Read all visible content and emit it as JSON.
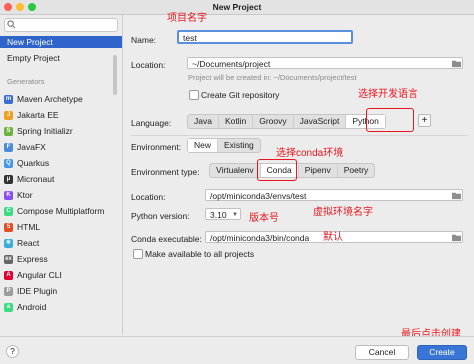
{
  "window": {
    "title": "New Project"
  },
  "sidebar": {
    "top_items": [
      {
        "label": "New Project"
      },
      {
        "label": "Empty Project"
      }
    ],
    "section_label": "Generators",
    "generators": [
      {
        "label": "Maven Archetype",
        "icon": "maven-icon",
        "color": "#3b6bd6",
        "glyph": "m"
      },
      {
        "label": "Jakarta EE",
        "icon": "jakarta-icon",
        "color": "#f0a020",
        "glyph": "J"
      },
      {
        "label": "Spring Initializr",
        "icon": "spring-icon",
        "color": "#6db33f",
        "glyph": "S"
      },
      {
        "label": "JavaFX",
        "icon": "javafx-icon",
        "color": "#4a8ed9",
        "glyph": "F"
      },
      {
        "label": "Quarkus",
        "icon": "quarkus-icon",
        "color": "#4695eb",
        "glyph": "Q"
      },
      {
        "label": "Micronaut",
        "icon": "micronaut-icon",
        "color": "#333333",
        "glyph": "μ"
      },
      {
        "label": "Ktor",
        "icon": "ktor-icon",
        "color": "#8a4ff0",
        "glyph": "K"
      },
      {
        "label": "Compose Multiplatform",
        "icon": "compose-icon",
        "color": "#3ddc84",
        "glyph": "C"
      },
      {
        "label": "HTML",
        "icon": "html-icon",
        "color": "#e44d26",
        "glyph": "5"
      },
      {
        "label": "React",
        "icon": "react-icon",
        "color": "#3aaed8",
        "glyph": "⚛"
      },
      {
        "label": "Express",
        "icon": "express-icon",
        "color": "#666666",
        "glyph": "ex"
      },
      {
        "label": "Angular CLI",
        "icon": "angular-icon",
        "color": "#dd0031",
        "glyph": "A"
      },
      {
        "label": "IDE Plugin",
        "icon": "plugin-icon",
        "color": "#9c9c9c",
        "glyph": "P"
      },
      {
        "label": "Android",
        "icon": "android-icon",
        "color": "#3ddc84",
        "glyph": "a"
      }
    ]
  },
  "form": {
    "name_label": "Name:",
    "name_value": "test",
    "location_label": "Location:",
    "location_value": "~/Documents/project",
    "location_hint": "Project will be created in: ~/Documents/project/test",
    "git_label": "Create Git repository",
    "language_label": "Language:",
    "languages": [
      {
        "label": "Java",
        "selected": false
      },
      {
        "label": "Kotlin",
        "selected": false
      },
      {
        "label": "Groovy",
        "selected": false
      },
      {
        "label": "JavaScript",
        "selected": false
      },
      {
        "label": "Python",
        "selected": true
      }
    ],
    "plus_label": "+",
    "environment_label": "Environment:",
    "environments": [
      {
        "label": "New",
        "selected": true
      },
      {
        "label": "Existing",
        "selected": false
      }
    ],
    "env_type_label": "Environment type:",
    "env_types": [
      {
        "label": "Virtualenv",
        "selected": false
      },
      {
        "label": "Conda",
        "selected": true
      },
      {
        "label": "Pipenv",
        "selected": false
      },
      {
        "label": "Poetry",
        "selected": false
      }
    ],
    "conda_location_label": "Location:",
    "conda_location_value": "/opt/miniconda3/envs/test",
    "python_version_label": "Python version:",
    "python_version_value": "3.10",
    "conda_exec_label": "Conda executable:",
    "conda_exec_value": "/opt/miniconda3/bin/conda",
    "available_label": "Make available to all projects"
  },
  "annotations": {
    "project_name": "项目名字",
    "select_language": "选择开发语言",
    "select_conda": "选择conda环境",
    "env_name": "虚拟环境名字",
    "version": "版本号",
    "default": "默认",
    "create_last": "最后点击创建"
  },
  "footer": {
    "help_label": "?",
    "cancel_label": "Cancel",
    "create_label": "Create"
  },
  "colors": {
    "accent": "#2f65ca",
    "annotation": "#e8171f",
    "create": "#3875d7"
  }
}
